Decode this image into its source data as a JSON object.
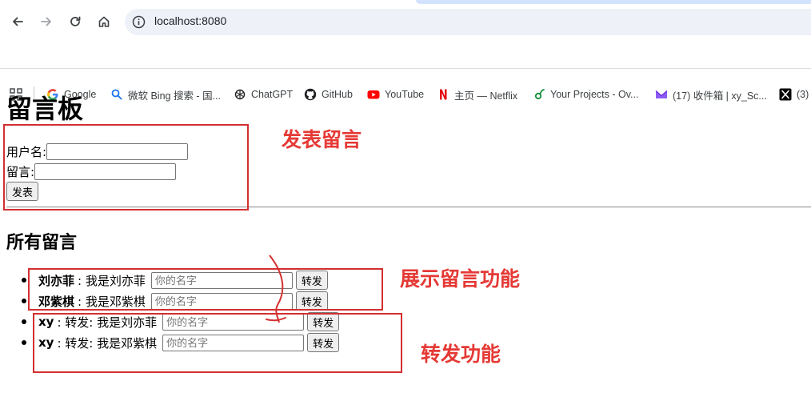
{
  "browser": {
    "url": "localhost:8080",
    "bookmarks": [
      {
        "label": "Google",
        "icon": "google-icon"
      },
      {
        "label": "微软 Bing 搜索 - 国...",
        "icon": "bing-search-icon"
      },
      {
        "label": "ChatGPT",
        "icon": "chatgpt-icon"
      },
      {
        "label": "GitHub",
        "icon": "github-icon"
      },
      {
        "label": "YouTube",
        "icon": "youtube-icon"
      },
      {
        "label": "主页 — Netflix",
        "icon": "netflix-icon"
      },
      {
        "label": "Your Projects - Ov...",
        "icon": "overleaf-icon"
      },
      {
        "label": "(17) 收件箱 | xy_Sc...",
        "icon": "proton-mail-icon"
      },
      {
        "label": "(3)",
        "icon": "x-icon"
      }
    ]
  },
  "page": {
    "title": "留言板",
    "form": {
      "username_label": "用户名:",
      "message_label": "留言:",
      "submit_label": "发表"
    },
    "section_title": "所有留言",
    "messages": [
      {
        "name": "刘亦菲",
        "text": ": 我是刘亦菲",
        "placeholder": "你的名字",
        "button": "转发"
      },
      {
        "name": "邓紫棋",
        "text": ": 我是邓紫棋",
        "placeholder": "你的名字",
        "button": "转发"
      },
      {
        "name": "xy",
        "text": ": 转发: 我是刘亦菲",
        "placeholder": "你的名字",
        "button": "转发"
      },
      {
        "name": "xy",
        "text": ": 转发: 我是邓紫棋",
        "placeholder": "你的名字",
        "button": "转发"
      }
    ]
  },
  "annotations": {
    "post": "发表留言",
    "display": "展示留言功能",
    "forward": "转发功能",
    "color": "#e53935"
  }
}
